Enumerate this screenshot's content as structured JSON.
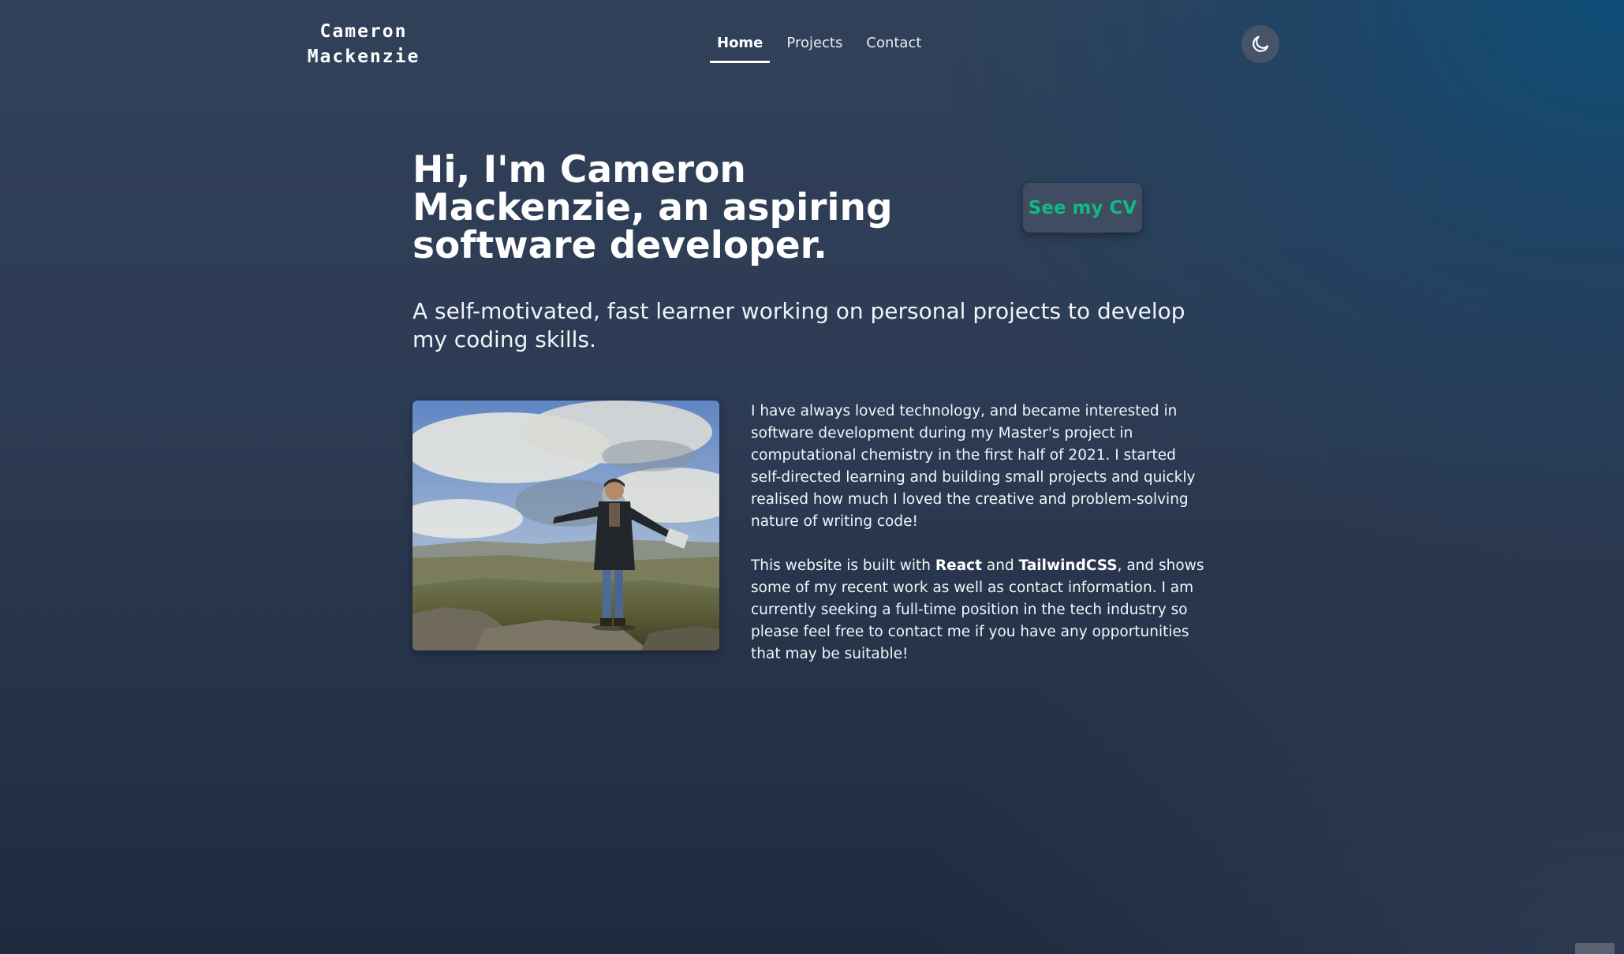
{
  "header": {
    "logo_line1": "Cameron",
    "logo_line2": "Mackenzie",
    "nav": [
      {
        "label": "Home",
        "active": true
      },
      {
        "label": "Projects",
        "active": false
      },
      {
        "label": "Contact",
        "active": false
      }
    ],
    "theme_toggle_icon": "moon-icon"
  },
  "hero": {
    "title": "Hi, I'm Cameron Mackenzie, an aspiring software developer.",
    "cv_button_label": "See my CV",
    "subtitle": "A self-motivated, fast learner working on personal projects to develop my coding skills."
  },
  "about": {
    "p1": "I have always loved technology, and became interested in software development during my Master's project in computational chemistry in the first half of 2021. I started self-directed learning and building small projects and quickly realised how much I loved the creative and problem-solving nature of writing code!",
    "p2_before": "This website is built with ",
    "p2_react": "React",
    "p2_and": " and ",
    "p2_tailwind": "TailwindCSS",
    "p2_after": ", and shows some of my recent work as well as contact information. I am currently seeking a full-time position in the tech industry so please feel free to contact me if you have any opportunities that may be suitable!"
  },
  "colors": {
    "accent": "#12b886",
    "button_bg": "#3f4c61",
    "background_dark": "#1f2a3e",
    "background_top_right": "#0c4e78"
  }
}
